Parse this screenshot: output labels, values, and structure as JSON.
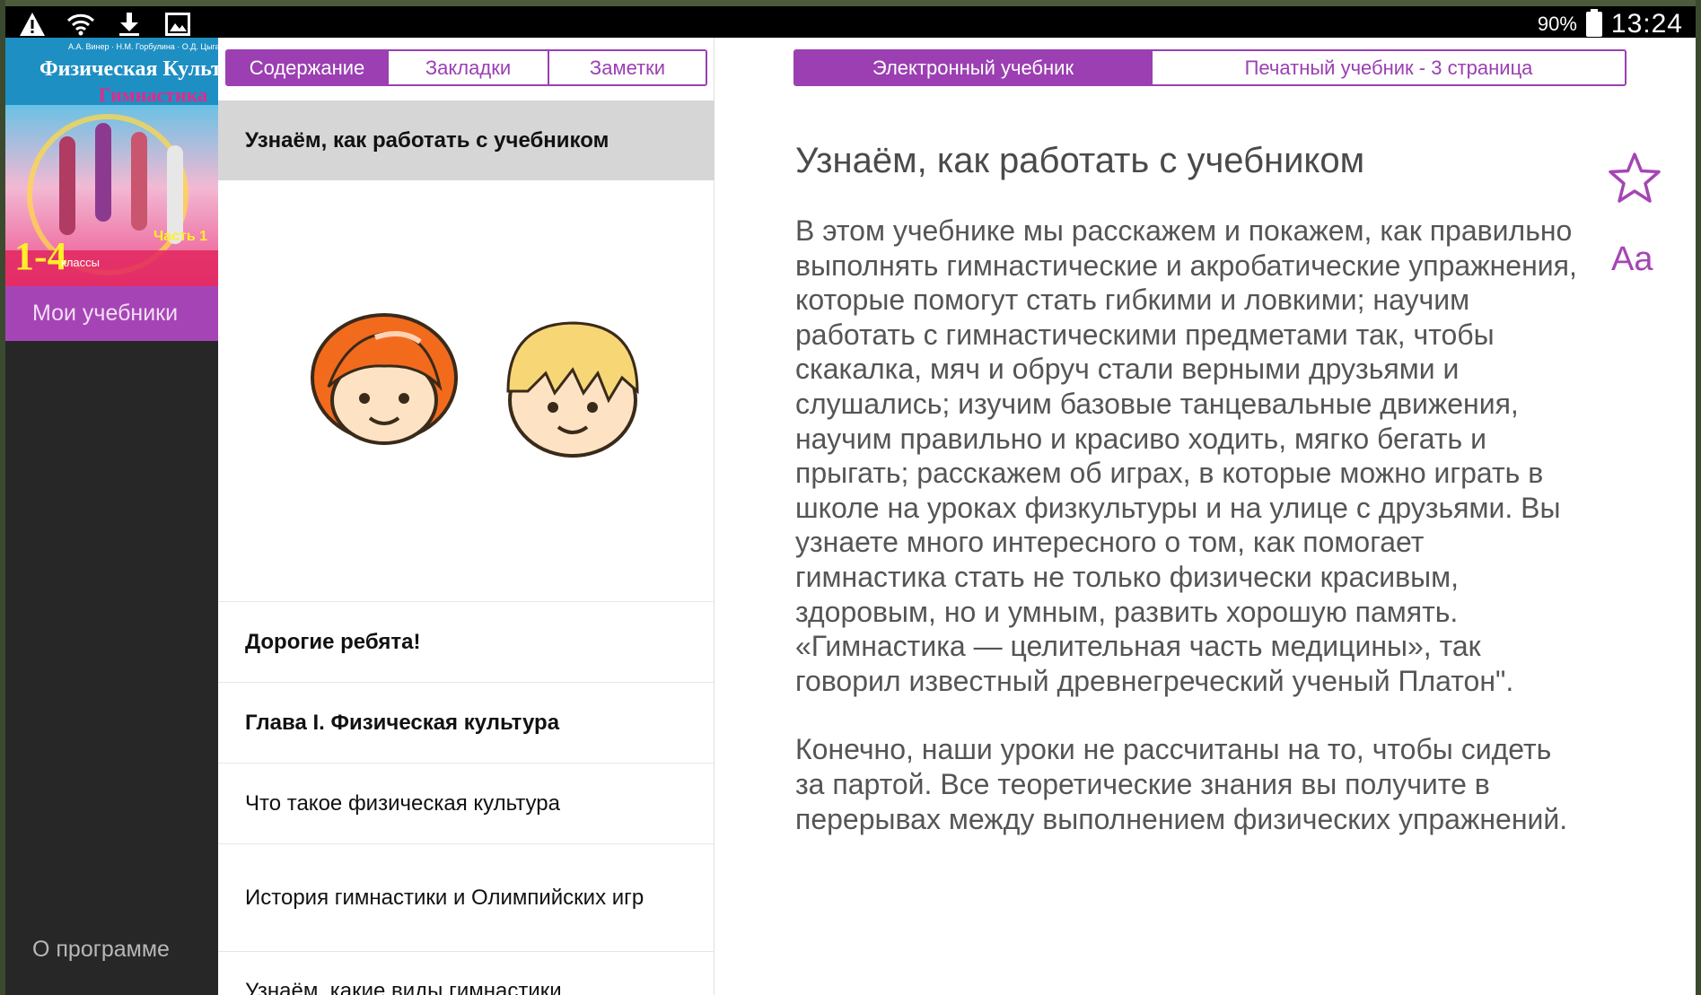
{
  "status_bar": {
    "icons": [
      "warning-icon",
      "wifi-icon",
      "download-icon",
      "image-icon"
    ],
    "battery": "90%",
    "time": "13:24"
  },
  "sidebar": {
    "cover": {
      "authors": "А.А. Винер · Н.М. Горбулина · О.Д. Цыганкова",
      "title": "Физическая Культура",
      "subtitle": "Гимнастика",
      "grade": "1-4",
      "grade_label": "классы",
      "part": "Часть 1"
    },
    "my_books": "Мои учебники",
    "about": "О программе"
  },
  "toc_tabs": [
    {
      "label": "Содержание",
      "active": true
    },
    {
      "label": "Закладки",
      "active": false
    },
    {
      "label": "Заметки",
      "active": false
    }
  ],
  "toc": {
    "selected": "Узнаём, как работать с учебником",
    "items": [
      {
        "label": "Дорогие ребята!",
        "bold": true
      },
      {
        "label": "Глава I. Физическая культура",
        "bold": true
      },
      {
        "label": "Что такое физическая культура",
        "bold": false
      },
      {
        "label": "История гимнастики и Олимпийских игр",
        "bold": false
      },
      {
        "label": "Узнаём, какие виды гимнастики",
        "bold": false
      }
    ]
  },
  "reader_tabs": [
    {
      "label": "Электронный учебник",
      "active": true
    },
    {
      "label": "Печатный учебник - 3 страница",
      "active": false
    }
  ],
  "reader": {
    "title": "Узнаём, как работать с учебником",
    "paragraphs": [
      "В этом учебнике мы расскажем и покажем, как правильно выполнять гимнастические и акробатические упражнения, которые помогут стать гибкими и ловкими; научим работать с гимнастическими предметами так, чтобы скакалка, мяч и обруч стали верными друзьями и слушались; изучим базовые танцевальные движения, научим правильно и красиво ходить, мягко бегать и прыгать; расскажем об играх, в которые можно играть в школе на уроках физкультуры и на улице с друзьями. Вы узнаете много интересного о том, как помогает гимнастика стать не только физически красивым, здоровым, но и умным, развить хорошую память. «Гимнастика — целительная часть медицины», так говорил известный древнегреческий ученый Платон\".",
      "Конечно, наши уроки не рассчитаны на то, чтобы сидеть за партой. Все теоретические знания вы получите в перерывах между выполнением физических упражнений."
    ],
    "bookmark_icon": "star-icon",
    "font_button": "Aa"
  },
  "colors": {
    "accent": "#9b3fb2",
    "sidebar_bg": "#272727",
    "selected_row": "#d6d6d6"
  }
}
